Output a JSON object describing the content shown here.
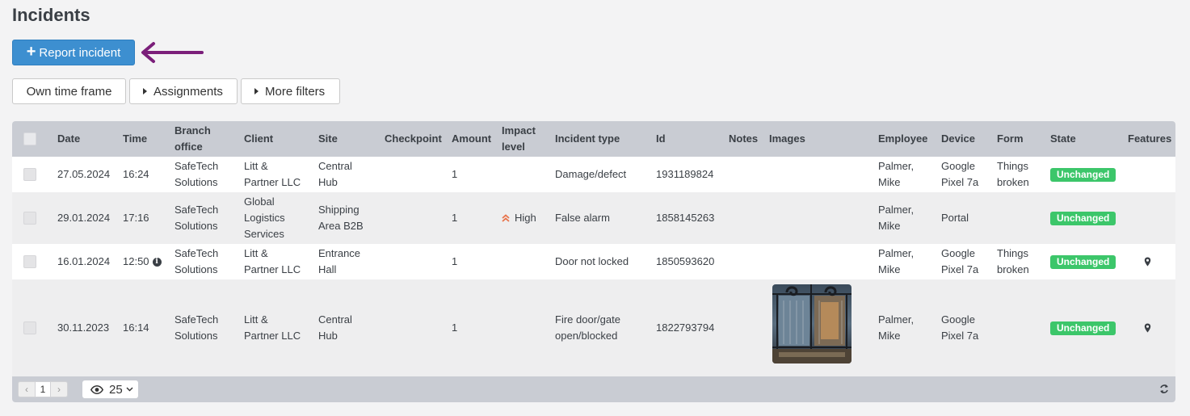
{
  "page": {
    "title": "Incidents"
  },
  "actions": {
    "report_label": "Report incident"
  },
  "filters": {
    "own_time_frame": "Own time frame",
    "assignments": "Assignments",
    "more_filters": "More filters"
  },
  "table": {
    "headers": {
      "date": "Date",
      "time": "Time",
      "branch_1": "Branch",
      "branch_2": "office",
      "client": "Client",
      "site": "Site",
      "checkpoint": "Checkpoint",
      "amount": "Amount",
      "impact_1": "Impact",
      "impact_2": "level",
      "incident_type": "Incident type",
      "id": "Id",
      "notes": "Notes",
      "images": "Images",
      "employee": "Employee",
      "device": "Device",
      "form": "Form",
      "state": "State",
      "features": "Features"
    },
    "rows": [
      {
        "date": "27.05.2024",
        "time": "16:24",
        "branch_1": "SafeTech",
        "branch_2": "Solutions",
        "client_1": "Litt &",
        "client_2": "Partner LLC",
        "site_1": "Central",
        "site_2": "Hub",
        "amount": "1",
        "impact": "",
        "incident_type": "Damage/defect",
        "id": "1931189824",
        "employee_1": "Palmer,",
        "employee_2": "Mike",
        "device_1": "Google",
        "device_2": "Pixel 7a",
        "form_1": "Things",
        "form_2": "broken",
        "state": "Unchanged"
      },
      {
        "date": "29.01.2024",
        "time": "17:16",
        "branch_1": "SafeTech",
        "branch_2": "Solutions",
        "client_1": "Global",
        "client_2": "Logistics",
        "client_3": "Services",
        "site_1": "Shipping",
        "site_2": "Area B2B",
        "amount": "1",
        "impact": "High",
        "incident_type": "False alarm",
        "id": "1858145263",
        "employee_1": "Palmer,",
        "employee_2": "Mike",
        "device": "Portal",
        "state": "Unchanged"
      },
      {
        "date": "16.01.2024",
        "time": "12:50",
        "branch_1": "SafeTech",
        "branch_2": "Solutions",
        "client_1": "Litt &",
        "client_2": "Partner LLC",
        "site_1": "Entrance",
        "site_2": "Hall",
        "amount": "1",
        "incident_type": "Door not locked",
        "id": "1850593620",
        "employee_1": "Palmer,",
        "employee_2": "Mike",
        "device_1": "Google",
        "device_2": "Pixel 7a",
        "form_1": "Things",
        "form_2": "broken",
        "state": "Unchanged"
      },
      {
        "date": "30.11.2023",
        "time": "16:14",
        "branch_1": "SafeTech",
        "branch_2": "Solutions",
        "client_1": "Litt &",
        "client_2": "Partner LLC",
        "site_1": "Central",
        "site_2": "Hub",
        "amount": "1",
        "incident_type_1": "Fire door/gate",
        "incident_type_2": "open/blocked",
        "id": "1822793794",
        "employee_1": "Palmer,",
        "employee_2": "Mike",
        "device_1": "Google",
        "device_2": "Pixel 7a",
        "state": "Unchanged"
      }
    ]
  },
  "footer": {
    "current_page": "1",
    "page_size": "25"
  },
  "colors": {
    "primary": "#3d8fd0",
    "badge_green": "#3cc66a",
    "impact_high": "#e8734a",
    "annotation_arrow": "#7b1f7a"
  },
  "icons": [
    "plus-icon",
    "arrow-left-icon",
    "caret-right-icon",
    "info-icon",
    "double-chevron-up-icon",
    "map-pin-icon",
    "eye-icon",
    "chevron-down-icon",
    "refresh-icon"
  ]
}
